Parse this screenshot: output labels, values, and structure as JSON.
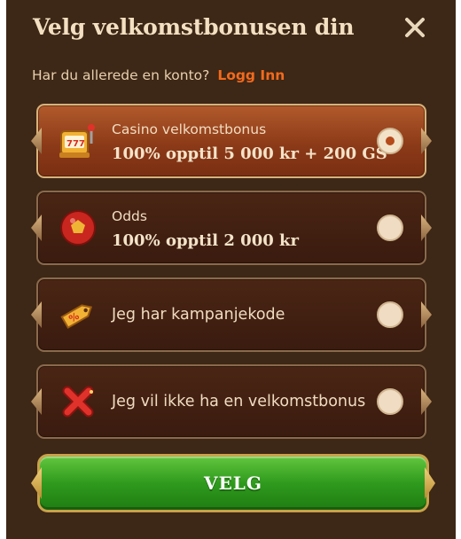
{
  "modal": {
    "title": "Velg velkomstbonusen din",
    "close_icon": "close-icon"
  },
  "login": {
    "prompt": "Har du allerede en konto?",
    "link": "Logg Inn"
  },
  "options": [
    {
      "id": "casino",
      "icon": "slot-machine-icon",
      "label": "Casino velkomstbonus",
      "value": "100% opptil 5 000 kr + 200 GS",
      "selected": true
    },
    {
      "id": "odds",
      "icon": "football-icon",
      "label": "Odds",
      "value": "100% opptil 2 000 kr",
      "selected": false
    },
    {
      "id": "promo",
      "icon": "coupon-tag-icon",
      "label": "Jeg har kampanjekode",
      "selected": false
    },
    {
      "id": "none",
      "icon": "red-x-icon",
      "label": "Jeg vil ikke ha en velkomstbonus",
      "selected": false
    }
  ],
  "submit": {
    "label": "VELG"
  },
  "colors": {
    "background": "#3d2716",
    "accent_link": "#f26a1c",
    "selected_option": "#a04a22",
    "button_green": "#2f9a1d",
    "gold_border": "#c9a24a"
  }
}
